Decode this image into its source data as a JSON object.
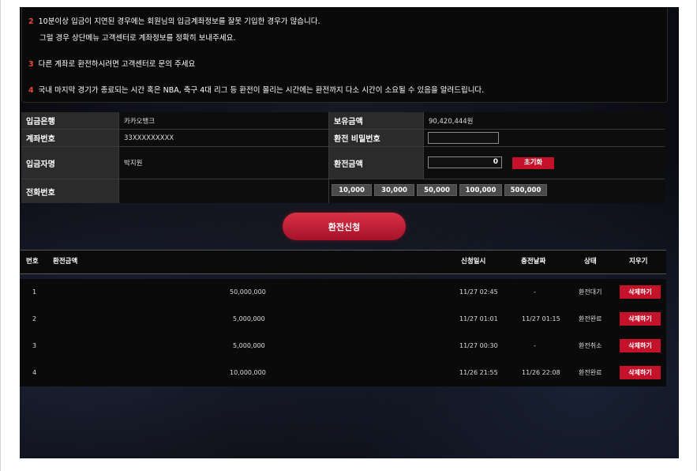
{
  "notice": {
    "items": [
      {
        "num": "2",
        "text": "10분이상 입금이 지연된 경우에는 회원님의 입금계좌정보를 잘못 기입한 경우가 많습니다.",
        "sub": "그럴 경우 상단메뉴 고객센터로 계좌정보를 정확히 보내주세요."
      },
      {
        "num": "3",
        "text": "다른 계좌로 환전하시려면 고객센터로 문의 주세요"
      },
      {
        "num": "4",
        "text": "국내 마지막 경기가 종료되는 시간 혹은 NBA, 축구 4대 리그 등 환전이 몰리는 시간에는 환전까지 다소 시간이 소요될 수 있음을 알려드립니다."
      }
    ]
  },
  "form": {
    "bank_label": "입금은행",
    "bank_value": "카카오뱅크",
    "balance_label": "보유금액",
    "balance_value": "90,420,444원",
    "account_label": "계좌번호",
    "account_value": "33XXXXXXXXX",
    "password_label": "환전 비밀번호",
    "password_value": "",
    "depositor_label": "입금자명",
    "depositor_value": "박지원",
    "amount_label": "환전금액",
    "amount_value": "0",
    "reset_label": "초기화",
    "phone_label": "전화번호",
    "phone_value": "",
    "quick_amounts": [
      "10,000",
      "30,000",
      "50,000",
      "100,000",
      "500,000"
    ]
  },
  "submit_label": "환전신청",
  "list": {
    "headers": {
      "no": "번호",
      "amount": "환전금액",
      "requested": "신청일시",
      "paid": "충전날짜",
      "status": "상태",
      "delete": "지우기"
    },
    "rows": [
      {
        "no": "1",
        "amount": "50,000,000",
        "requested": "11/27 02:45",
        "paid": "-",
        "status": "환전대기",
        "delete": "삭제하기"
      },
      {
        "no": "2",
        "amount": "5,000,000",
        "requested": "11/27 01:01",
        "paid": "11/27 01:15",
        "status": "환전완료",
        "delete": "삭제하기"
      },
      {
        "no": "3",
        "amount": "5,000,000",
        "requested": "11/27 00:30",
        "paid": "-",
        "status": "환전취소",
        "delete": "삭제하기"
      },
      {
        "no": "4",
        "amount": "10,000,000",
        "requested": "11/26 21:55",
        "paid": "11/26 22:08",
        "status": "환전완료",
        "delete": "삭제하기"
      }
    ]
  },
  "colors": {
    "accent": "#c4122b",
    "notice_number": "#e84a3c"
  }
}
